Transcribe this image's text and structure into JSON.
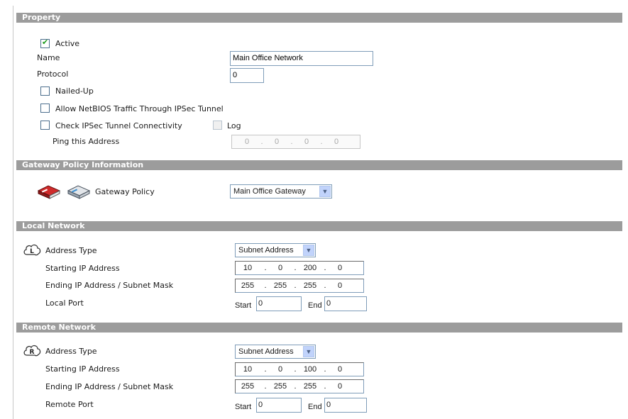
{
  "property": {
    "title": "Property",
    "active_label": "Active",
    "active_checked": true,
    "name_label": "Name",
    "name_value": "Main Office Network",
    "protocol_label": "Protocol",
    "protocol_value": "0",
    "nailed_up_label": "Nailed-Up",
    "netbios_label": "Allow NetBIOS Traffic Through IPSec Tunnel",
    "check_conn_label": "Check IPSec Tunnel Connectivity",
    "log_label": "Log",
    "ping_label": "Ping this Address",
    "ping_octets": [
      "0",
      "0",
      "0",
      "0"
    ]
  },
  "gateway": {
    "title": "Gateway Policy Information",
    "policy_label": "Gateway Policy",
    "policy_value": "Main Office Gateway"
  },
  "local": {
    "title": "Local Network",
    "address_type_label": "Address Type",
    "address_type_value": "Subnet Address",
    "start_ip_label": "Starting IP Address",
    "start_ip": [
      "10",
      "0",
      "200",
      "0"
    ],
    "end_ip_label": "Ending IP Address / Subnet Mask",
    "end_ip": [
      "255",
      "255",
      "255",
      "0"
    ],
    "port_label": "Local Port",
    "start_label": "Start",
    "start_value": "0",
    "end_label": "End",
    "end_value": "0"
  },
  "remote": {
    "title": "Remote Network",
    "address_type_label": "Address Type",
    "address_type_value": "Subnet Address",
    "start_ip_label": "Starting IP Address",
    "start_ip": [
      "10",
      "0",
      "100",
      "0"
    ],
    "end_ip_label": "Ending IP Address / Subnet Mask",
    "end_ip": [
      "255",
      "255",
      "255",
      "0"
    ],
    "port_label": "Remote Port",
    "start_label": "Start",
    "start_value": "0",
    "end_label": "End",
    "end_value": "0"
  },
  "icons": {
    "gateway": [
      "router-red-icon",
      "router-gray-icon"
    ],
    "local": "local-network-cloud-icon",
    "remote": "remote-network-cloud-icon"
  },
  "colors": {
    "section_bar": "#9c9c9c",
    "input_border": "#7f9db9",
    "check_mark": "#1d9b1d"
  }
}
